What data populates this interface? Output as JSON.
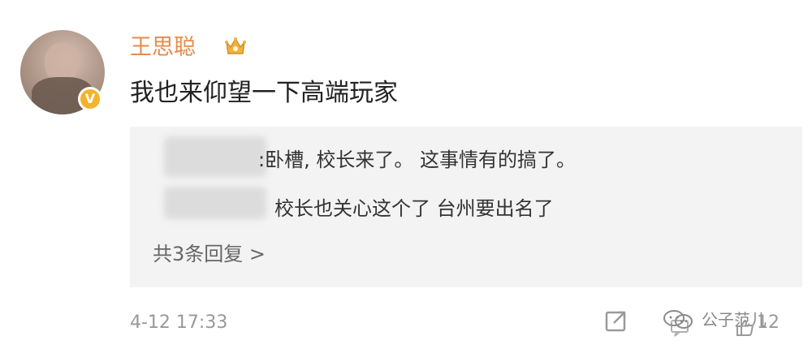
{
  "comment": {
    "username": "王思聪",
    "content": "我也来仰望一下高端玩家",
    "timestamp": "4-12 17:33",
    "verified_badge": "V",
    "like_count": "12"
  },
  "replies": [
    {
      "author": "",
      "text": ":卧槽, 校长来了。 这事情有的搞了。"
    },
    {
      "author": "",
      "text": "校长也关心这个了 台州要出名了"
    }
  ],
  "more_replies_label": "共3条回复 >",
  "watermark": {
    "text": "公子范儿",
    "icon": "wechat-icon"
  },
  "icons": {
    "share": "share-icon",
    "crown": "crown-icon",
    "comment": "comment-icon",
    "like": "like-icon"
  },
  "colors": {
    "username": "#e88a4a",
    "reply_background": "#f3f3f3",
    "verified_badge": "#f4b32b"
  }
}
